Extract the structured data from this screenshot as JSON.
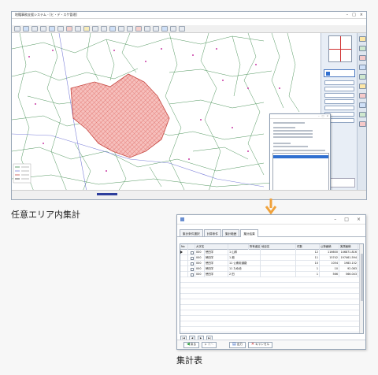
{
  "captions": {
    "top": "任意エリア内集計",
    "bottom": "集計表"
  },
  "table_window": {
    "tabs": [
      "集計条件選択",
      "計算条件",
      "集計範囲",
      "集計結果"
    ],
    "active_tab": 3,
    "columns": [
      "No",
      "大字名",
      "",
      "所有者区分",
      "地目名",
      "件数",
      "公簿面積",
      "実測面積"
    ],
    "rows": [
      {
        "no": "",
        "code": "000",
        "name": "徳田字",
        "cat": "1 山林",
        "chimoku": "",
        "count": "12",
        "area_kobo": "116600",
        "area_jissoku": "146871.816"
      },
      {
        "no": "",
        "code": "000",
        "name": "徳田字",
        "cat": "1 畑",
        "chimoku": "",
        "count": "11",
        "area_kobo": "15742",
        "area_jissoku": "197461.594"
      },
      {
        "no": "",
        "code": "000",
        "name": "徳田字",
        "cat": "11 公衆用道路",
        "chimoku": "",
        "count": "10",
        "area_kobo": "1054",
        "area_jissoku": "1983.152"
      },
      {
        "no": "",
        "code": "000",
        "name": "徳田字",
        "cat": "11 ため池",
        "chimoku": "",
        "count": "1",
        "area_kobo": "10",
        "area_jissoku": "92.083"
      },
      {
        "no": "",
        "code": "000",
        "name": "徳田字",
        "cat": "2 田",
        "chimoku": "",
        "count": "1",
        "area_kobo": "566",
        "area_jissoku": "566.043"
      }
    ],
    "buttons": {
      "back": "戻る",
      "next": "次へ",
      "output": "出力",
      "cancel": "キャンセル"
    },
    "nav": [
      "|◀",
      "◀",
      "▶",
      "▶|"
    ]
  },
  "map_window": {
    "title": "地籍事務支援システム - [ヒ・デ・スケ管理]"
  },
  "colors": {
    "area_fill": "#f2a7a3",
    "area_hatch": "#e06a64",
    "selection": "#2f6fd0",
    "arrow": "#f0a23b"
  },
  "icons": [
    "window-icon",
    "back-icon",
    "output-icon",
    "cancel-icon",
    "down-arrow"
  ]
}
